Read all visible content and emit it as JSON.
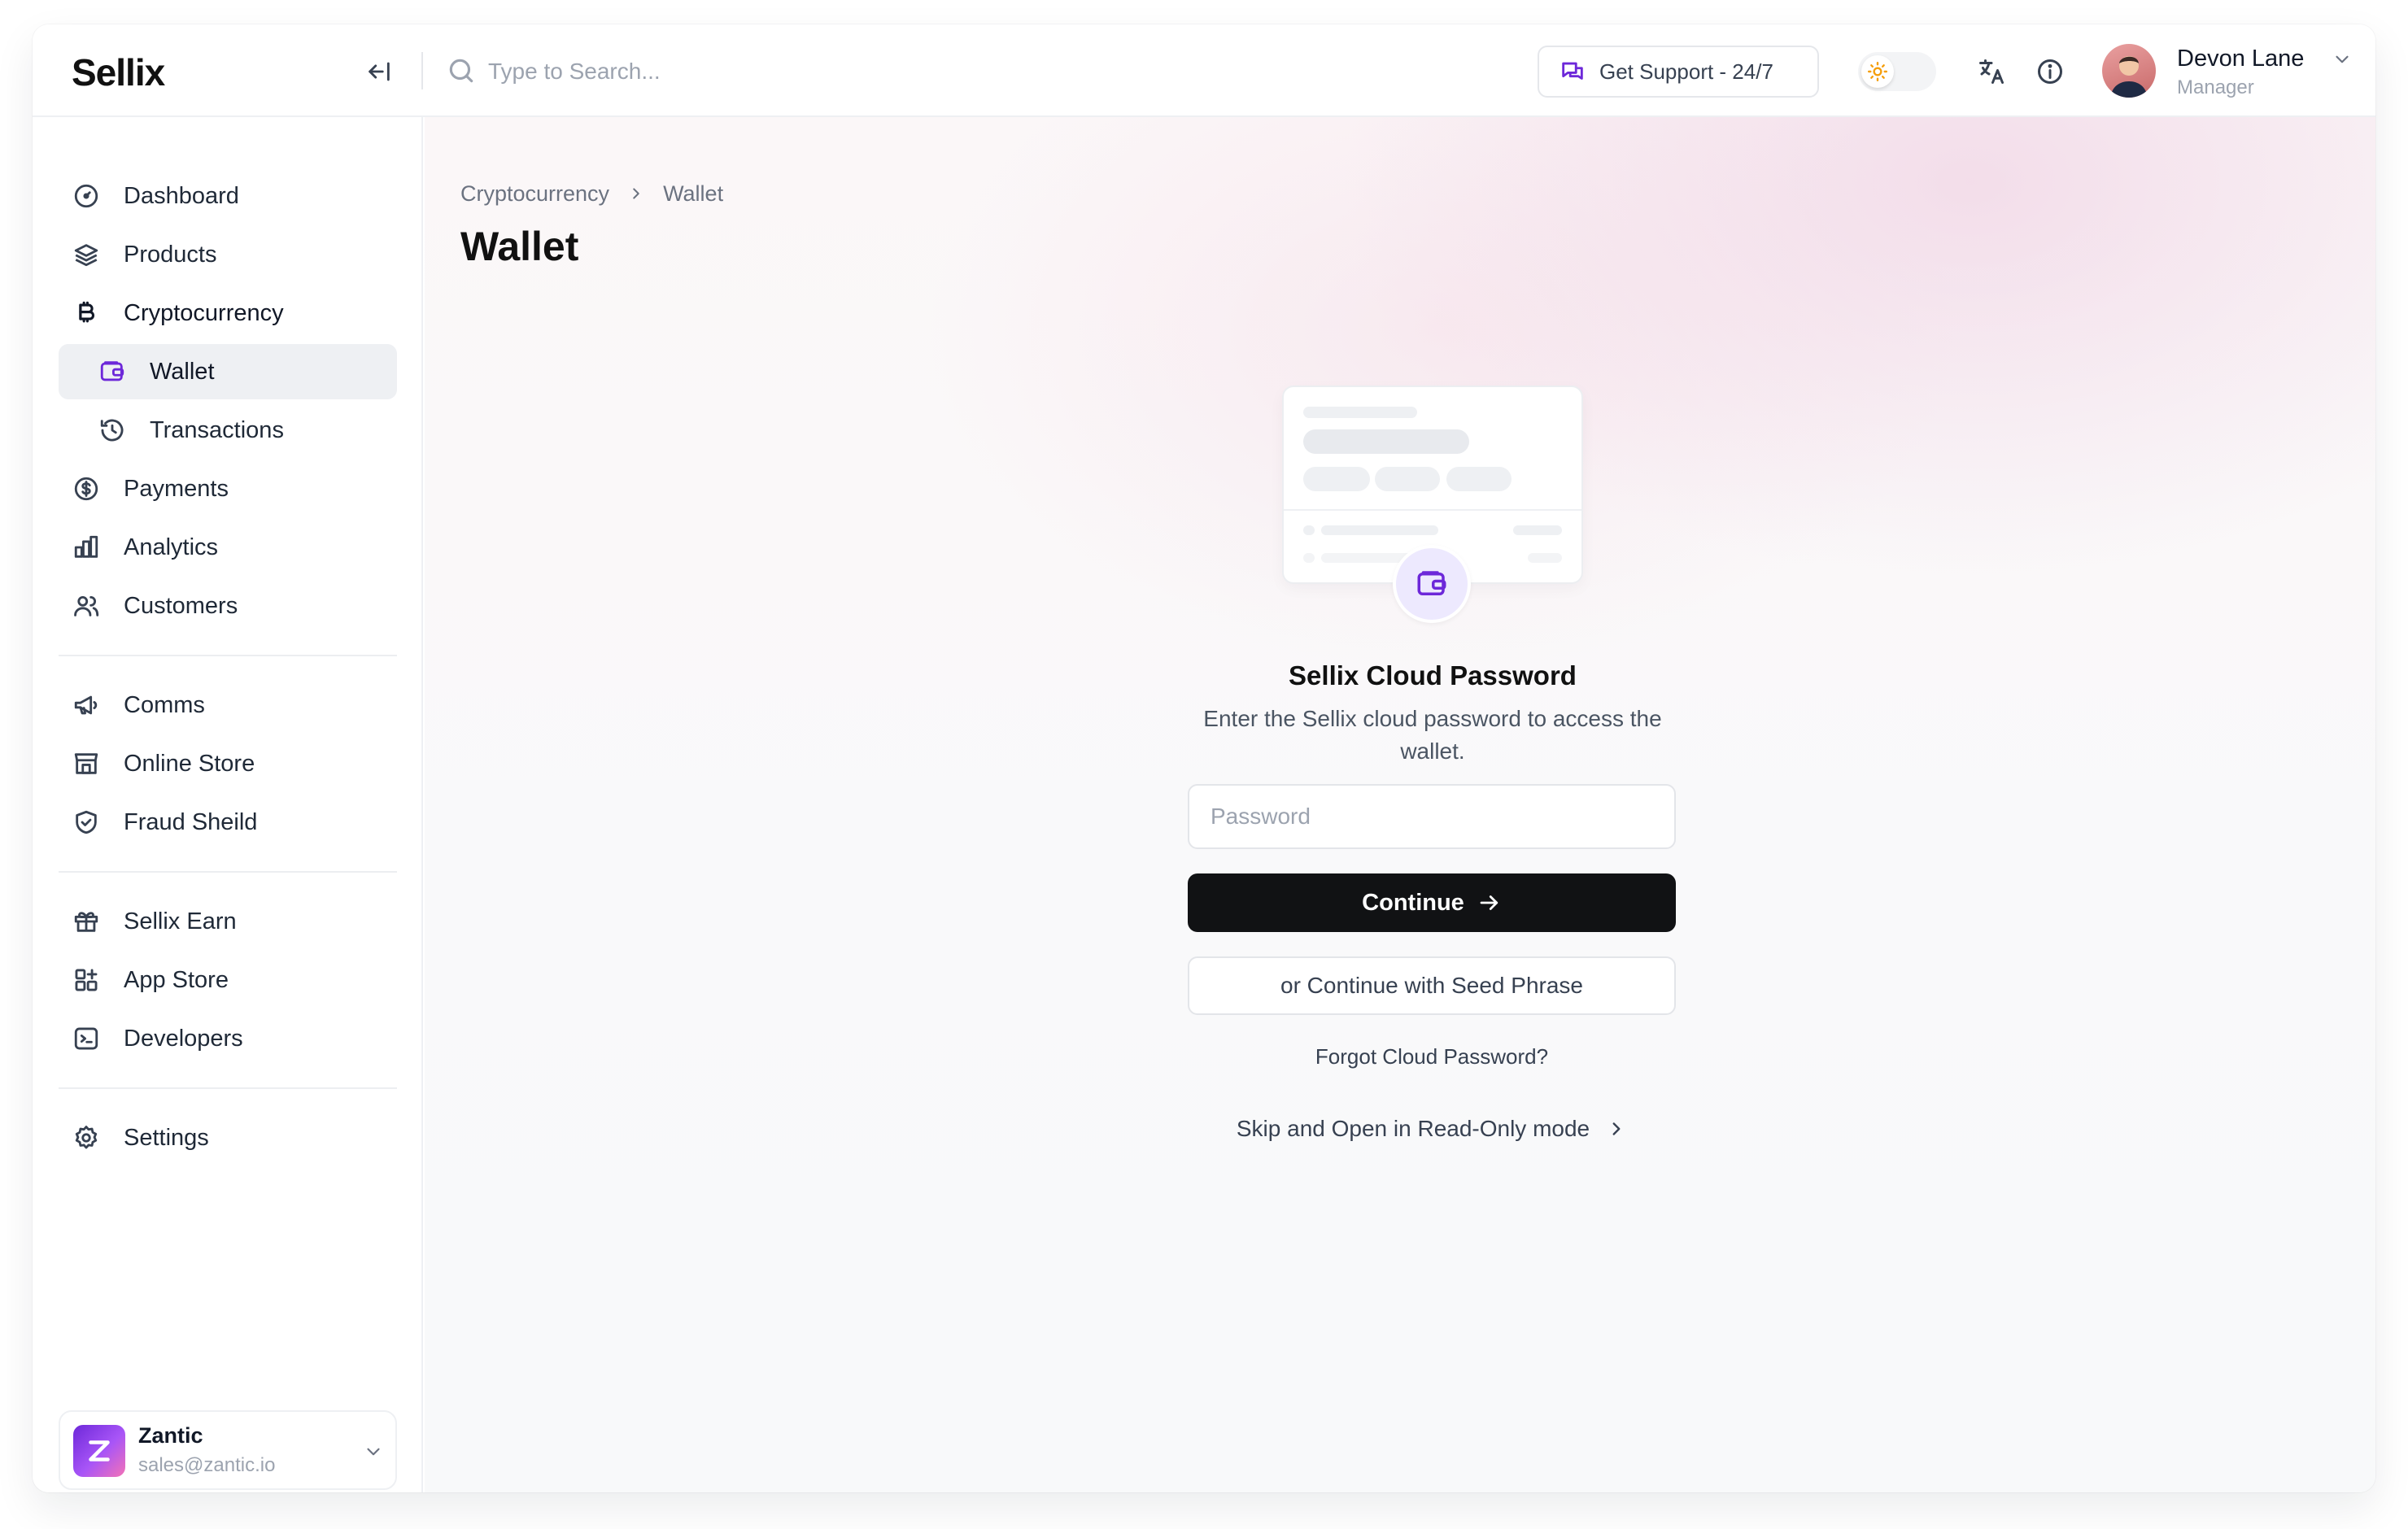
{
  "app": {
    "logo": "Sellix"
  },
  "header": {
    "search_placeholder": "Type to Search...",
    "support_label": "Get Support - 24/7",
    "user": {
      "name": "Devon Lane",
      "role": "Manager"
    }
  },
  "sidebar": {
    "items": [
      {
        "label": "Dashboard",
        "icon": "dashboard-icon"
      },
      {
        "label": "Products",
        "icon": "layers-icon"
      },
      {
        "label": "Cryptocurrency",
        "icon": "bitcoin-icon"
      },
      {
        "label": "Wallet",
        "icon": "wallet-icon",
        "active": true
      },
      {
        "label": "Transactions",
        "icon": "history-icon"
      },
      {
        "label": "Payments",
        "icon": "dollar-circle-icon"
      },
      {
        "label": "Analytics",
        "icon": "bar-chart-icon"
      },
      {
        "label": "Customers",
        "icon": "users-icon"
      },
      {
        "label": "Comms",
        "icon": "megaphone-icon"
      },
      {
        "label": "Online Store",
        "icon": "store-icon"
      },
      {
        "label": "Fraud Sheild",
        "icon": "shield-check-icon"
      },
      {
        "label": "Sellix Earn",
        "icon": "gift-icon"
      },
      {
        "label": "App Store",
        "icon": "apps-icon"
      },
      {
        "label": "Developers",
        "icon": "terminal-icon"
      },
      {
        "label": "Settings",
        "icon": "gear-icon"
      }
    ],
    "store": {
      "name": "Zantic",
      "email": "sales@zantic.io"
    }
  },
  "main": {
    "breadcrumb": [
      "Cryptocurrency",
      "Wallet"
    ],
    "title": "Wallet",
    "form": {
      "title": "Sellix Cloud Password",
      "description": "Enter the Sellix cloud password to access the wallet.",
      "password_placeholder": "Password",
      "continue_label": "Continue",
      "seed_label": "or Continue with Seed Phrase",
      "forgot_label": "Forgot Cloud Password?",
      "skip_label": "Skip and Open in Read-Only mode"
    }
  },
  "colors": {
    "accent": "#6d28d9",
    "primary_button": "#111214",
    "active_nav": "#eef0f3"
  }
}
